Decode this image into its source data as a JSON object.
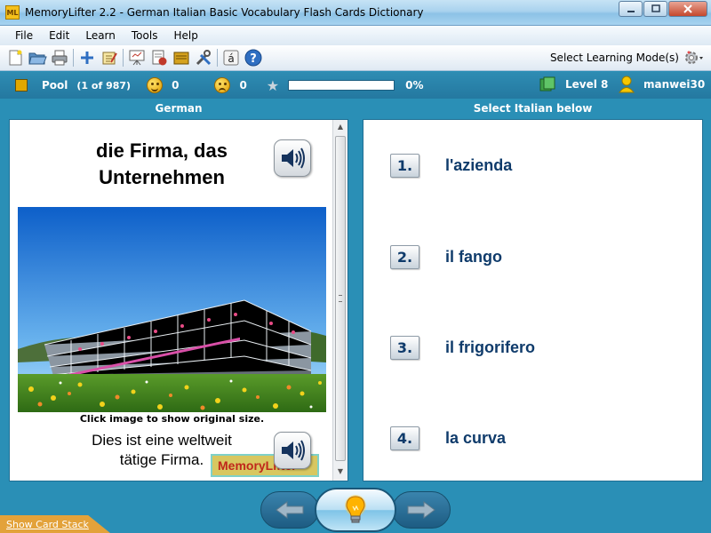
{
  "window": {
    "title": "MemoryLifter 2.2 - German Italian Basic Vocabulary Flash Cards Dictionary",
    "app_icon_text": "ML"
  },
  "menu": [
    "File",
    "Edit",
    "Learn",
    "Tools",
    "Help"
  ],
  "toolbar": {
    "icons": [
      "new-file-icon",
      "open-folder-icon",
      "print-icon",
      "add-card-icon",
      "edit-icon",
      "slideshow-icon",
      "print-cards-icon",
      "card-box-icon",
      "tools-icon",
      "special-char-icon",
      "help-icon"
    ],
    "special_char_label": "á",
    "help_label": "?",
    "learning_mode_label": "Select Learning Mode(s)"
  },
  "status": {
    "pool_label": "Pool",
    "pool_count": "(1 of 987)",
    "correct_count": "0",
    "wrong_count": "0",
    "progress_fraction": 0.0,
    "progress_text": "0%",
    "level": "Level 8",
    "user": "manwei30"
  },
  "columns": {
    "question_header": "German",
    "answer_header": "Select Italian below"
  },
  "card": {
    "question_line1": "die Firma, das",
    "question_line2": "Unternehmen",
    "image_caption": "Click image to show original size.",
    "example_line1": "Dies ist eine weltweit",
    "example_line2": "tätige Firma.",
    "logo_text": "MemoryLifter"
  },
  "answers": [
    {
      "number": "1.",
      "text": "l'azienda"
    },
    {
      "number": "2.",
      "text": "il fango"
    },
    {
      "number": "3.",
      "text": "il frigorifero"
    },
    {
      "number": "4.",
      "text": "la curva"
    }
  ],
  "footer": {
    "card_stack_link": "Show Card Stack"
  },
  "colors": {
    "accent_blue": "#2a8fb6",
    "answer_text": "#0f3b6b",
    "progress_fill": "#4fb54a"
  }
}
